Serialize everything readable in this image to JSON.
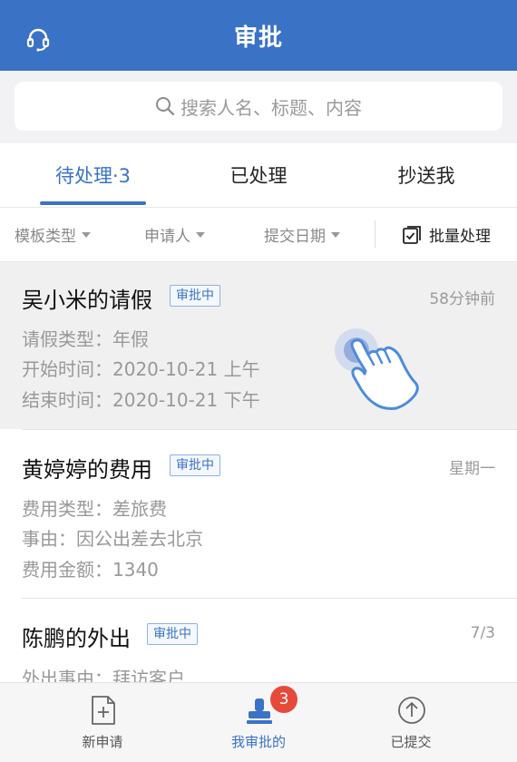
{
  "header": {
    "title": "审批",
    "support_icon": "headset-icon"
  },
  "search": {
    "placeholder": "搜索人名、标题、内容",
    "icon": "search-icon"
  },
  "tabs": [
    {
      "label": "待处理·3",
      "active": true
    },
    {
      "label": "已处理",
      "active": false
    },
    {
      "label": "抄送我",
      "active": false
    }
  ],
  "filters": {
    "items": [
      {
        "label": "模板类型"
      },
      {
        "label": "申请人"
      },
      {
        "label": "提交日期"
      }
    ],
    "batch_label": "批量处理",
    "batch_icon": "checkbox-list-icon"
  },
  "cards": [
    {
      "title": "吴小米的请假",
      "status": "审批中",
      "time": "58分钟前",
      "details": [
        "请假类型：年假",
        "开始时间：2020-10-21 上午",
        "结束时间：2020-10-21 下午"
      ]
    },
    {
      "title": "黄婷婷的费用",
      "status": "审批中",
      "time": "星期一",
      "details": [
        "费用类型：差旅费",
        "事由：因公出差去北京",
        "费用金额：1340"
      ]
    },
    {
      "title": "陈鹏的外出",
      "status": "审批中",
      "time": "7/3",
      "details": [
        "外出事由：拜访客户"
      ]
    }
  ],
  "bottom_nav": [
    {
      "label": "新申请",
      "icon": "new-document-icon",
      "active": false
    },
    {
      "label": "我审批的",
      "icon": "stamp-icon",
      "active": true,
      "badge": "3"
    },
    {
      "label": "已提交",
      "icon": "upload-circle-icon",
      "active": false
    }
  ],
  "colors": {
    "primary": "#3a72c6",
    "badge_red": "#e64a3b",
    "highlight_bg": "#f0f0f1"
  }
}
